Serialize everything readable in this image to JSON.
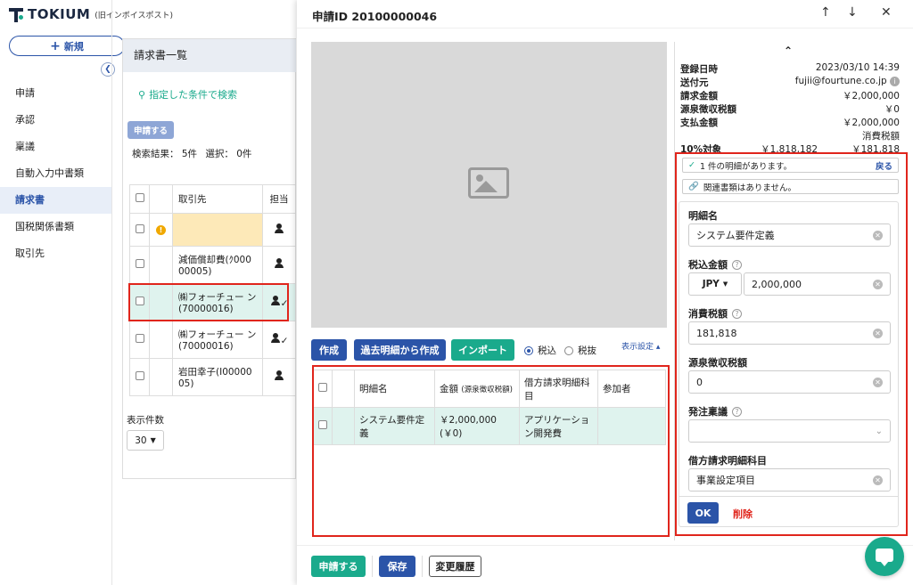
{
  "app": {
    "brand": "TOKIUM",
    "brand_sub": "(旧インボイスポスト)",
    "new_button": "新規"
  },
  "nav": {
    "items": [
      "申請",
      "承認",
      "稟議",
      "自動入力中書類",
      "請求書",
      "国税関係書類",
      "取引先"
    ],
    "active": "請求書"
  },
  "list": {
    "header": "請求書一覧",
    "search_link": "指定した条件で検索",
    "apply_button": "申請する",
    "result_label": "検索結果：",
    "result_count": "5件",
    "selected_label": "選択：",
    "selected_count": "0件",
    "columns": [
      "取引先",
      "担当"
    ],
    "rows": [
      {
        "partner": "",
        "warning": true
      },
      {
        "partner": "減価償却費(ｸ000 00005)"
      },
      {
        "partner": "㈱フォーチュー ン(70000016)",
        "highlight": true
      },
      {
        "partner": "㈱フォーチュー ン(70000016)"
      },
      {
        "partner": "岩田幸子(I00000 05)"
      }
    ],
    "per_page_label": "表示件数",
    "per_page_value": "30"
  },
  "detail": {
    "title": "申請ID 20100000046",
    "buttons": {
      "create": "作成",
      "create_from_past": "過去明細から作成",
      "import": "インポート"
    },
    "tax_options": {
      "incl": "税込",
      "excl": "税抜"
    },
    "display_settings": "表示設定",
    "table": {
      "columns": [
        "明細名",
        "金額",
        "(源泉徴収税額)",
        "借方請求明細科目",
        "参加者"
      ],
      "rows": [
        {
          "name": "システム要件定義",
          "amount": "￥2,000,000",
          "withholding": "(￥0)",
          "account": "アプリケーション開発費",
          "participants": ""
        }
      ]
    },
    "info": {
      "registered_label": "登録日時",
      "registered_value": "2023/03/10 14:39",
      "sender_label": "送付元",
      "sender_value": "fujii@fourtune.co.jp",
      "billed_label": "請求金額",
      "billed_value": "￥2,000,000",
      "withholding_label": "源泉徴収税額",
      "withholding_value": "￥0",
      "payment_label": "支払金額",
      "payment_value": "￥2,000,000",
      "tax_note": "消費税額",
      "rate_label": "10%対象",
      "rate_base": "￥1,818,182",
      "rate_tax": "￥181,818"
    },
    "details_bar": {
      "text": "1 件の明細があります。",
      "back": "戻る"
    },
    "related_bar": {
      "text": "関連書類はありません。"
    },
    "form": {
      "item_name_label": "明細名",
      "item_name_value": "システム要件定義",
      "amount_label": "税込金額",
      "currency": "JPY",
      "amount_value": "2,000,000",
      "tax_label": "消費税額",
      "tax_value": "181,818",
      "withholding_label": "源泉徴収税額",
      "withholding_value": "0",
      "order_label": "発注稟議",
      "order_value": "",
      "account_label": "借方請求明細科目",
      "account_value": "事業設定項目",
      "ok": "OK",
      "delete": "削除"
    },
    "footer": {
      "apply": "申請する",
      "save": "保存",
      "history": "変更履歴"
    }
  }
}
